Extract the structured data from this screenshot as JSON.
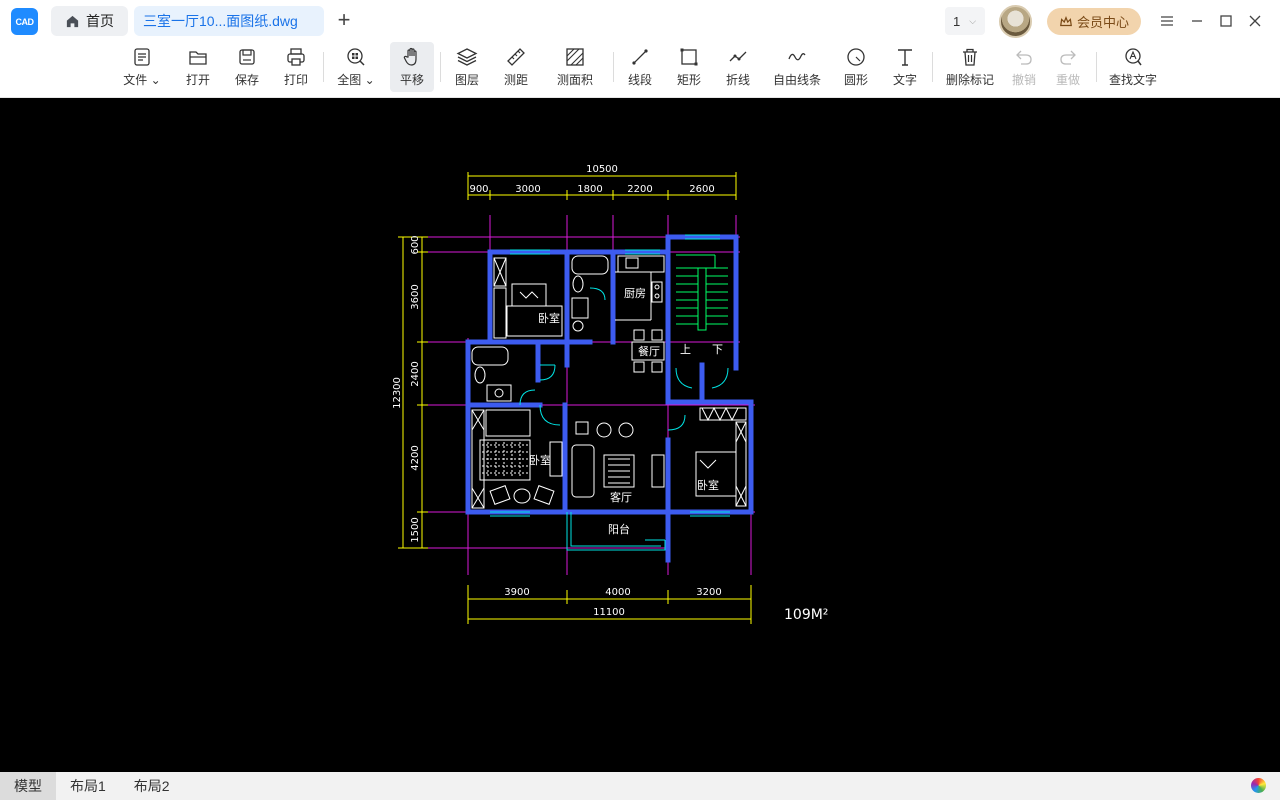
{
  "app": {
    "logo_text": "CAD"
  },
  "tabs": {
    "home_label": "首页",
    "file_label": "三室一厅10...面图纸.dwg",
    "add_label": "+"
  },
  "page_select": {
    "value": "1"
  },
  "vip": {
    "label": "会员中心"
  },
  "toolbar": {
    "items": [
      {
        "label": "文件",
        "icon": "file-icon",
        "dropdown": true
      },
      {
        "label": "打开",
        "icon": "folder-open-icon"
      },
      {
        "label": "保存",
        "icon": "save-icon"
      },
      {
        "label": "打印",
        "icon": "print-icon"
      },
      {
        "label": "全图",
        "icon": "zoom-fit-icon",
        "dropdown": true
      },
      {
        "label": "平移",
        "icon": "hand-pan-icon",
        "active": true
      },
      {
        "label": "图层",
        "icon": "layers-icon"
      },
      {
        "label": "测距",
        "icon": "ruler-icon"
      },
      {
        "label": "测面积",
        "icon": "area-measure-icon"
      },
      {
        "label": "线段",
        "icon": "line-segment-icon"
      },
      {
        "label": "矩形",
        "icon": "rectangle-icon"
      },
      {
        "label": "折线",
        "icon": "polyline-icon"
      },
      {
        "label": "自由线条",
        "icon": "freehand-icon"
      },
      {
        "label": "圆形",
        "icon": "circle-icon"
      },
      {
        "label": "文字",
        "icon": "text-icon"
      },
      {
        "label": "删除标记",
        "icon": "trash-icon"
      },
      {
        "label": "撤销",
        "icon": "undo-icon",
        "disabled": true
      },
      {
        "label": "重做",
        "icon": "redo-icon",
        "disabled": true
      },
      {
        "label": "查找文字",
        "icon": "find-text-icon"
      }
    ]
  },
  "drawing": {
    "total_top": "10500",
    "top_segments": [
      "900",
      "3000",
      "1800",
      "2200",
      "2600"
    ],
    "left_total": "12300",
    "left_segments": [
      "600",
      "3600",
      "2400",
      "4200",
      "1500"
    ],
    "bottom_segments": [
      "3900",
      "4000",
      "3200"
    ],
    "bottom_total": "11100",
    "area_label": "109M²",
    "rooms": {
      "bedroom_top": "卧室",
      "kitchen": "厨房",
      "dining": "餐厅",
      "stairs_up": "上",
      "stairs_down": "下",
      "bedroom_left": "卧室",
      "living": "客厅",
      "bedroom_right": "卧室",
      "balcony": "阳台"
    },
    "colors": {
      "wall": "#3d5cf0",
      "dim": "#ffff00",
      "axis": "#d91ad9",
      "window": "#00e5e5",
      "furniture": "#ffffff",
      "stair": "#00ff66"
    }
  },
  "layouts": [
    "模型",
    "布局1",
    "布局2"
  ]
}
